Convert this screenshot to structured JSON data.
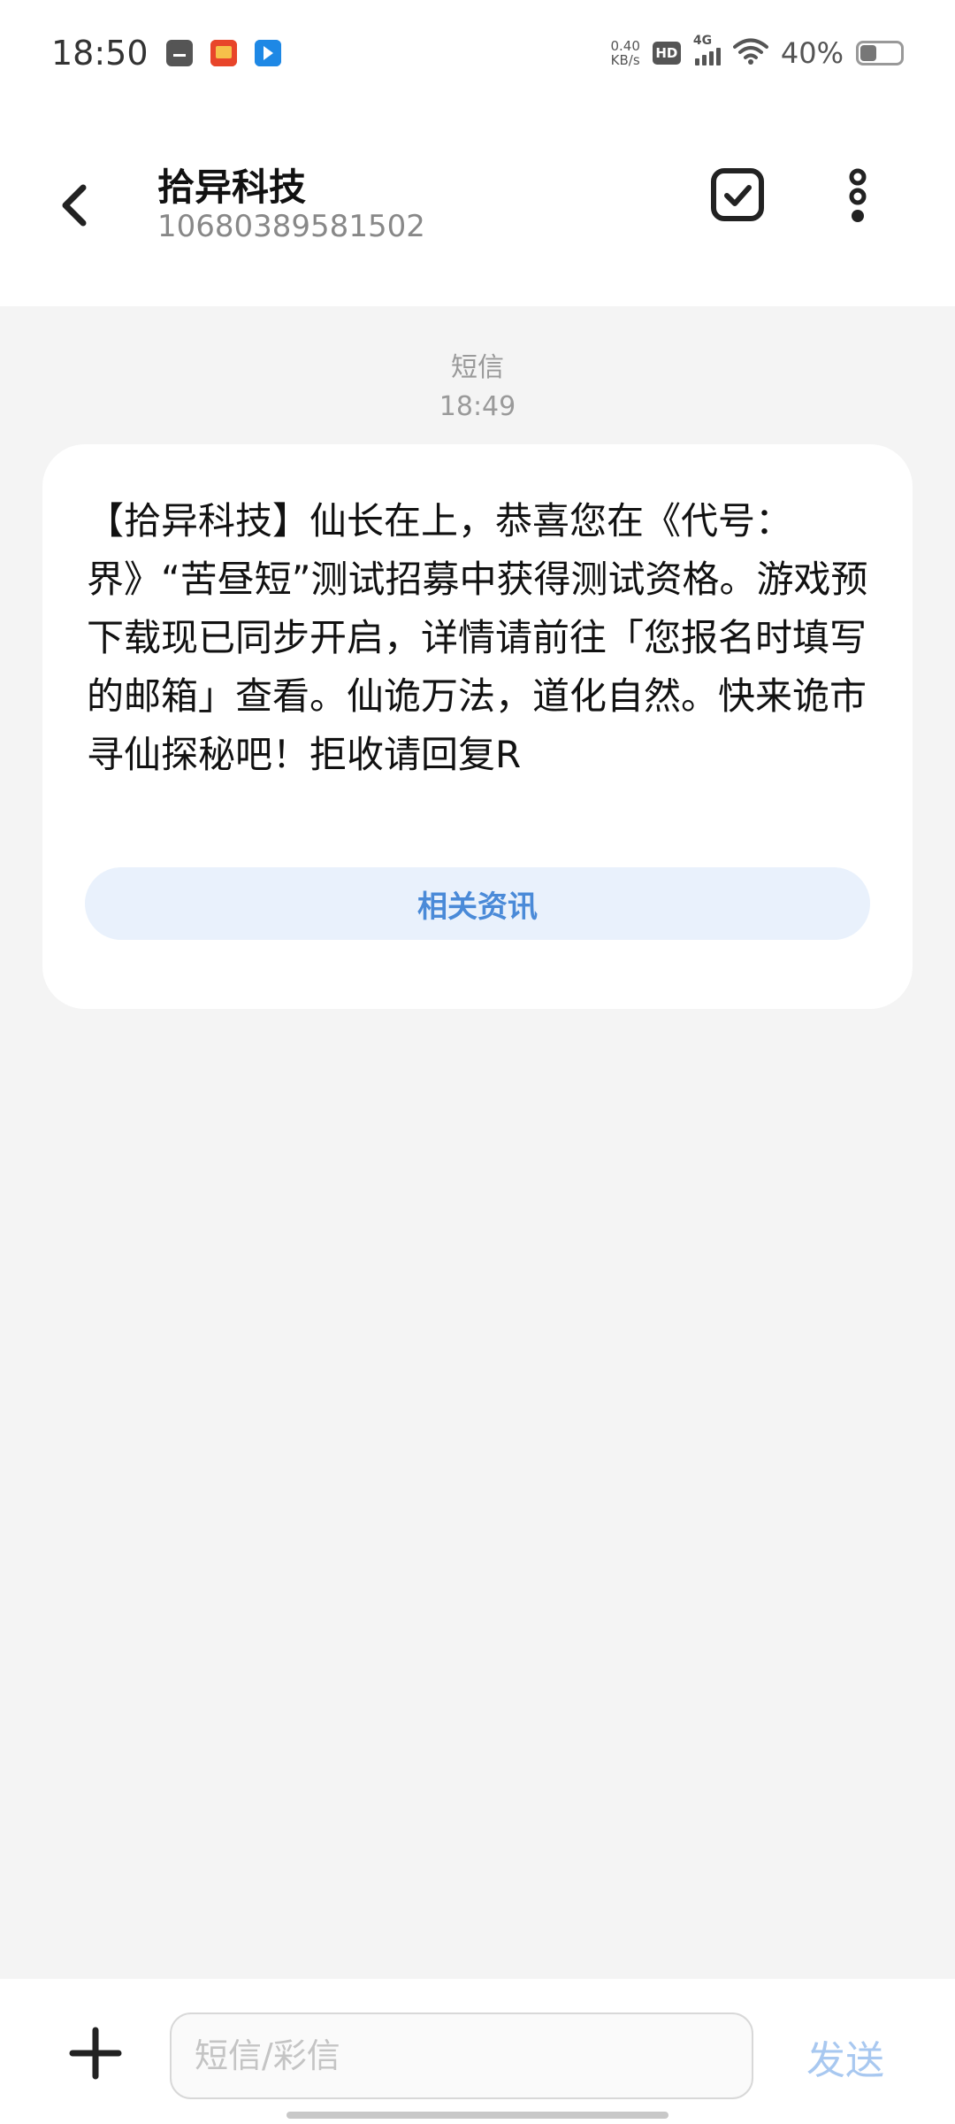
{
  "status_bar": {
    "time": "18:50",
    "net_speed_value": "0.40",
    "net_speed_unit": "KB/s",
    "hd_badge": "HD",
    "network_label": "4G",
    "battery_percent_text": "40%",
    "battery_level": 0.4
  },
  "header": {
    "title": "拾异科技",
    "subtitle": "10680389581502"
  },
  "thread": {
    "meta_type": "短信",
    "meta_time": "18:49",
    "message_text": "【拾异科技】仙长在上，恭喜您在《代号：界》“苦昼短”测试招募中获得测试资格。游戏预下载现已同步开启，详情请前往「您报名时填写的邮箱」查看。仙诡万法，道化自然。快来诡市寻仙探秘吧！拒收请回复R",
    "chip_label": "相关资讯"
  },
  "composer": {
    "placeholder": "短信/彩信",
    "send_label": "发送"
  },
  "colors": {
    "accent": "#4a8ad8",
    "chip_bg": "#e9f1fc",
    "send_disabled": "#a8c8f0"
  }
}
